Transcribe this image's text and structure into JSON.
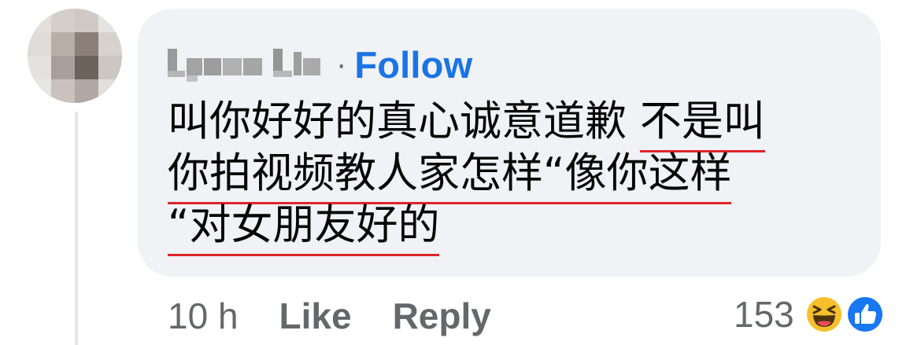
{
  "comment": {
    "author_name_blurred": "Lynne Lin",
    "separator": "·",
    "follow_label": "Follow",
    "text_lines": [
      {
        "plain": "叫你好好的真心诚意道歉 ",
        "underlined": "不是叫"
      },
      {
        "plain": "",
        "underlined": "你拍视频教人家怎样“像你这样"
      },
      {
        "plain": "",
        "underlined": "“对女朋友好的"
      }
    ]
  },
  "actions": {
    "time": "10 h",
    "like_label": "Like",
    "reply_label": "Reply"
  },
  "reactions": {
    "count": "153",
    "icons": [
      "haha-icon",
      "like-icon"
    ]
  },
  "colors": {
    "bubble_bg": "#f0f2f5",
    "follow_blue": "#1b74e4",
    "meta_gray": "#65676b",
    "underline_red": "#e0242a"
  }
}
